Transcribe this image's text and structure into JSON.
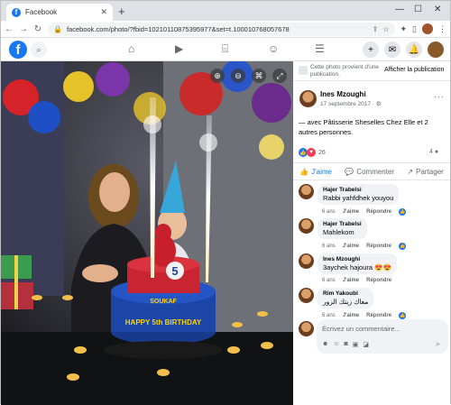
{
  "browser": {
    "tab_title": "Facebook",
    "url": "facebook.com/photo/?fbid=10210110875395977&set=t.100010768057678"
  },
  "fb": {
    "logo": "f"
  },
  "photo": {
    "cake_text": "HAPPY 5th BIRTHDAY",
    "cake_name": "SOUKAF",
    "candle_number": "5"
  },
  "side": {
    "notice_text": "Cette photo provient d'une publication.",
    "notice_button": "Afficher la publication",
    "poster_name": "Ines Mzoughi",
    "post_date": "17 septembre 2017 · ",
    "caption": "— avec Pâtisserie Sheselles Chez Elle et 2 autres personnes.",
    "reactions_count": "26",
    "comments_count": "4",
    "actions": {
      "like": "J'aime",
      "comment": "Commenter",
      "share": "Partager"
    },
    "comments": [
      {
        "author": "Hajer Trabelsi",
        "text": "Rabbi yahfdhek youyou",
        "time": "6 ans",
        "like": "J'aime",
        "reply": "Répondre",
        "reacted": true
      },
      {
        "author": "Hajer Trabelsi",
        "text": "Mahlekom",
        "time": "6 ans",
        "like": "J'aime",
        "reply": "Répondre",
        "reacted": true
      },
      {
        "author": "Ines Mzoughi",
        "text": "3aychek hajoura 😍😍",
        "time": "6 ans",
        "like": "J'aime",
        "reply": "Répondre",
        "reacted": false
      },
      {
        "author": "Rim Yakoubi",
        "text": "معاك زيتك الزور",
        "time": "6 ans",
        "like": "J'aime",
        "reply": "Répondre",
        "reacted": true
      }
    ],
    "composer_placeholder": "Écrivez un commentaire..."
  }
}
